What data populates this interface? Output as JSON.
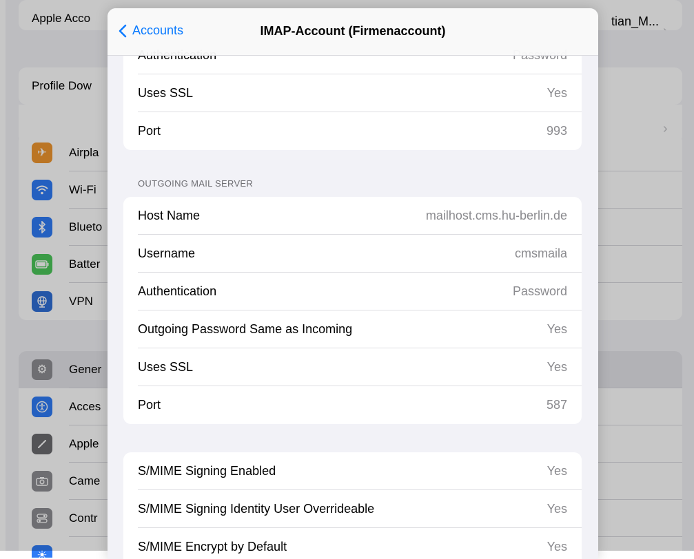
{
  "background": {
    "apple_account_label": "Apple Acco",
    "account_name_partial": "tian_M...",
    "profile_downloaded_label": "Profile Dow",
    "settings_items": [
      {
        "label": "Airpla",
        "icon": "airplane-icon",
        "color": "#f0962f"
      },
      {
        "label": "Wi-Fi",
        "icon": "wifi-icon",
        "color": "#2f7cf6"
      },
      {
        "label": "Blueto",
        "icon": "bluetooth-icon",
        "color": "#2f7cf6"
      },
      {
        "label": "Batter",
        "icon": "battery-icon",
        "color": "#4cc75a"
      },
      {
        "label": "VPN",
        "icon": "vpn-globe-icon",
        "color": "#2f6fd6"
      }
    ],
    "settings_items_2": [
      {
        "label": "Gener",
        "icon": "gear-icon",
        "color": "#8e8e93"
      },
      {
        "label": "Acces",
        "icon": "accessibility-icon",
        "color": "#2f7cf6"
      },
      {
        "label": "Apple",
        "icon": "pencil-icon",
        "color": "#6b6b6f"
      },
      {
        "label": "Came",
        "icon": "camera-icon",
        "color": "#8e8e93"
      },
      {
        "label": "Contr",
        "icon": "control-center-icon",
        "color": "#8e8e93"
      }
    ]
  },
  "sheet": {
    "back_label": "Accounts",
    "title": "IMAP-Account (Firmenaccount)",
    "incoming_rows": [
      {
        "key": "Authentication",
        "value": "Password"
      },
      {
        "key": "Uses SSL",
        "value": "Yes"
      },
      {
        "key": "Port",
        "value": "993"
      }
    ],
    "outgoing_header": "OUTGOING MAIL SERVER",
    "outgoing_rows": [
      {
        "key": "Host Name",
        "value": "mailhost.cms.hu-berlin.de"
      },
      {
        "key": "Username",
        "value": "cmsmaila"
      },
      {
        "key": "Authentication",
        "value": "Password"
      },
      {
        "key": "Outgoing Password Same as Incoming",
        "value": "Yes"
      },
      {
        "key": "Uses SSL",
        "value": "Yes"
      },
      {
        "key": "Port",
        "value": "587"
      }
    ],
    "smime_rows": [
      {
        "key": "S/MIME Signing Enabled",
        "value": "Yes"
      },
      {
        "key": "S/MIME Signing Identity User Overrideable",
        "value": "Yes"
      },
      {
        "key": "S/MIME Encrypt by Default",
        "value": "Yes"
      }
    ]
  },
  "colors": {
    "accent": "#0a7aff",
    "secondary_text": "#8a8a8e",
    "grouped_background": "#f2f2f7"
  }
}
